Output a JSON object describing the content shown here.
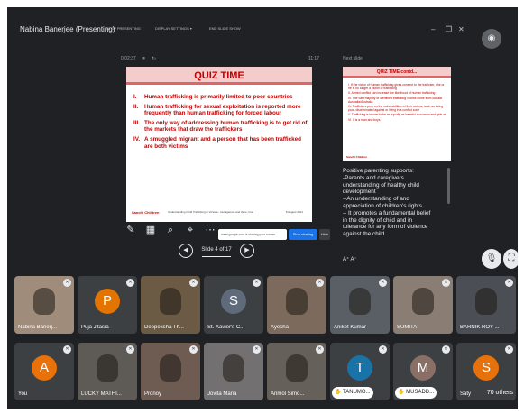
{
  "top_bar": {
    "presenter_title": "Nabina Banerjee (Presenting)",
    "stop_presenting": "STOP PRESENTING",
    "display_settings": "DISPLAY SETTINGS ▾",
    "end_session": "END SLIDE SHOW"
  },
  "presenter_view": {
    "elapsed_time": "0:02:37",
    "clock": "11:17",
    "slide": {
      "title": "QUIZ TIME",
      "items": [
        {
          "num": "I.",
          "text": "Human trafficking is primarily limited to poor countries"
        },
        {
          "num": "II.",
          "text": "Human trafficking for sexual exploitation is reported more frequently than human trafficking for forced labour"
        },
        {
          "num": "III.",
          "text": "The only way of addressing human trafficking is to get rid of the markets that draw the traffickers"
        },
        {
          "num": "IV.",
          "text": "A smuggled migrant and a person that has been trafficked are both victims"
        }
      ],
      "logo": "Sanchi Children",
      "footnote": "Understanding Child Trafficking in Victoria - Hol agamsu and there, how",
      "date": "8 August 2021"
    },
    "search_text": "meet.google.com is sharing your screen.",
    "stop_sharing": "Stop sharing",
    "hide": "Hide",
    "slide_counter": "Slide 4 of 17",
    "next_slide": {
      "label": "Next slide",
      "title": "QUIZ TIME contd...",
      "items": [
        "I. If the victim of human trafficking gives consent to the trafficker, she or he is no longer a victim of trafficking",
        "II. Armed conflict can increase the likelihood of human trafficking",
        "III. The vast majority of identified trafficking victims come from outside Australia/Australia",
        "IV. Traffickers prey on the vulnerabilities of their victims, such as being poor, discriminated against or living in a conflict zone",
        "V. Trafficking is known to be as equally as harmful to women and girls as",
        "VI. It is a man and boys"
      ],
      "logo": "Sanchi Children"
    },
    "notes": [
      "Positive parenting supports:",
      "-Parents and caregivers",
      "understanding of healthy child",
      "development",
      "--An understanding of and",
      "appreciation of children's rights",
      "-- It promotes a fundamental belief",
      "in the dignity of child and in",
      "tolerance for any form of violence",
      "against the child"
    ],
    "notes_font_controls": "A⁺  A⁻"
  },
  "participants": [
    {
      "name": "Nabina Banerj...",
      "type": "video",
      "color": "#a08c7a"
    },
    {
      "name": "Puja Jitasia",
      "type": "avatar",
      "initial": "P",
      "color": "#e37400"
    },
    {
      "name": "Deepeksha Th...",
      "type": "video",
      "color": "#6b5a44"
    },
    {
      "name": "St. Xavier's C...",
      "type": "avatar",
      "initial": "S",
      "color": "#5f6b7a"
    },
    {
      "name": "Ayesha",
      "type": "video",
      "color": "#7c6a5c"
    },
    {
      "name": "Aniket Kumar",
      "type": "video",
      "color": "#5a5f66"
    },
    {
      "name": "SUMITA",
      "type": "video",
      "color": "#8a7d74"
    },
    {
      "name": "BARNIK ROY-...",
      "type": "video",
      "color": "#4b4f55"
    },
    {
      "name": "You",
      "type": "avatar",
      "initial": "A",
      "color": "#e8710a"
    },
    {
      "name": "LUCKY MATHI...",
      "type": "video",
      "color": "#5e5a55"
    },
    {
      "name": "Pronoy",
      "type": "video",
      "color": "#6e5c52"
    },
    {
      "name": "Jovita Maria",
      "type": "video",
      "color": "#727070"
    },
    {
      "name": "Anmol Simo...",
      "type": "video",
      "color": "#66605a"
    },
    {
      "name": "TANUMO...",
      "type": "avatar",
      "initial": "T",
      "color": "#1a73a8",
      "pill": true
    },
    {
      "name": "MUSADD...",
      "type": "avatar",
      "initial": "M",
      "color": "#8a6f66",
      "pill": true
    },
    {
      "name": "Saty",
      "type": "avatar",
      "initial": "S",
      "color": "#e8710a"
    }
  ],
  "extra_participants": "70 others",
  "colors": {
    "background": "#202124",
    "tile": "#3c4043",
    "slide_red": "#c00000",
    "accent": "#1a73e8"
  }
}
